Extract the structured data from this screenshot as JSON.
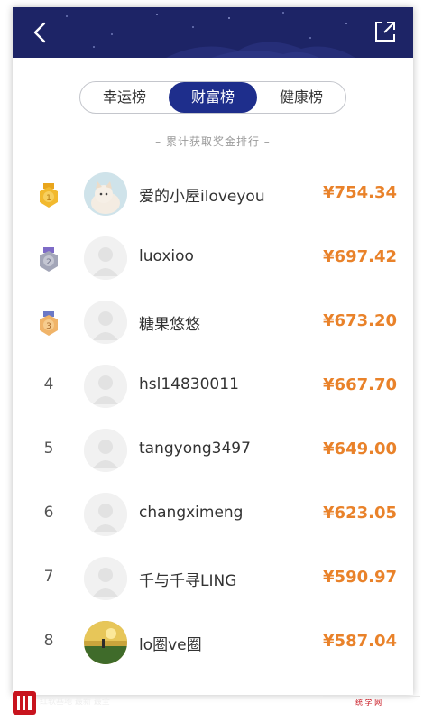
{
  "header": {
    "back_icon": "chevron-left-icon",
    "share_icon": "share-export-icon",
    "bg_color": "#1d2466"
  },
  "tabs": [
    {
      "label": "幸运榜",
      "active": false
    },
    {
      "label": "财富榜",
      "active": true
    },
    {
      "label": "健康榜",
      "active": false
    }
  ],
  "subtitle": "– 累计获取奖金排行 –",
  "ranking": [
    {
      "rank": "1",
      "medal": "gold",
      "name": "爱的小屋iloveyou",
      "amount": "¥754.34",
      "avatar": "cat-photo"
    },
    {
      "rank": "2",
      "medal": "silver",
      "name": "luoxioo",
      "amount": "¥697.42",
      "avatar": "default"
    },
    {
      "rank": "3",
      "medal": "bronze",
      "name": "糖果悠悠",
      "amount": "¥673.20",
      "avatar": "default"
    },
    {
      "rank": "4",
      "medal": "",
      "name": "hsl14830011",
      "amount": "¥667.70",
      "avatar": "default"
    },
    {
      "rank": "5",
      "medal": "",
      "name": "tangyong3497",
      "amount": "¥649.00",
      "avatar": "default"
    },
    {
      "rank": "6",
      "medal": "",
      "name": "changximeng",
      "amount": "¥623.05",
      "avatar": "default"
    },
    {
      "rank": "7",
      "medal": "",
      "name": "千与千寻LING",
      "amount": "¥590.97",
      "avatar": "default"
    },
    {
      "rank": "8",
      "medal": "",
      "name": "lo圈ve圈",
      "amount": "¥587.04",
      "avatar": "landscape-photo"
    }
  ],
  "colors": {
    "accent": "#1e2e8c",
    "amount": "#e9822a",
    "gold": "#f2b92e",
    "silver": "#a3a6b8",
    "bronze": "#f0b469"
  },
  "watermark": {
    "logo_letter": "IIJ",
    "caption": "红软基地 最新 最全",
    "box_text": "统 学 网"
  }
}
